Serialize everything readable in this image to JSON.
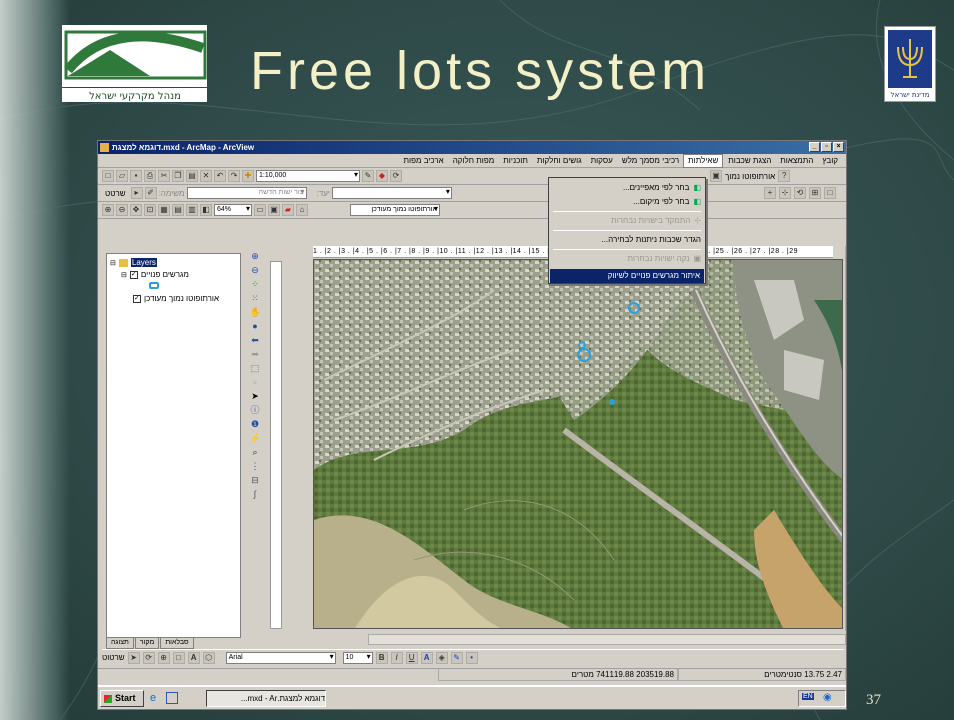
{
  "slide": {
    "title": "Free lots system",
    "page_number": "37",
    "logo_text": "מנהל מקרקעי ישראל",
    "emblem_text": "מדינת ישראל"
  },
  "window": {
    "title": "דוגמא למצגת.mxd - ArcMap - ArcView",
    "buttons": [
      "_",
      "▫",
      "×"
    ]
  },
  "menubar": {
    "items": [
      "קובץ",
      "התמצאות",
      "הצגת שכבות",
      "שאילתות",
      "רכיבי מסמך מלש",
      "עסקות",
      "גושים וחלקות",
      "תוכניות",
      "מפות חלוקה",
      "ארכיב מפות"
    ],
    "active_index": 3
  },
  "toolbar1": {
    "scale": "1:10,000",
    "right_item": "אורתופוטו נמוך"
  },
  "toolbar2": {
    "draw_label": "שרטט",
    "task_label": "משימה:",
    "task_value": "צור ישות חדשה",
    "target_label": "יעד:"
  },
  "toolbar3": {
    "zoom": "64%",
    "layer_combo": "אורתופוטו נמוך מעודכן",
    "number": "0"
  },
  "dropdown": {
    "items": [
      {
        "label": "בחר לפי מאפיינים...",
        "state": "normal"
      },
      {
        "label": "בחר לפי מיקום...",
        "state": "normal"
      },
      {
        "label": "התמקד בישויות נבחרות",
        "state": "disabled"
      },
      {
        "label": "הגדר שכבות ניתנות לבחירה...",
        "state": "normal"
      },
      {
        "label": "נקה ישויות נבחרות",
        "state": "disabled"
      },
      {
        "label": "איתור מגרשים פנויים לשיווק",
        "state": "selected"
      }
    ]
  },
  "toc": {
    "root": "Layers",
    "layers": [
      "מגרשים פנויים",
      "אורתופוטו נמוך מעודכן"
    ],
    "tabs": [
      "תצוגה",
      "מקור",
      "סבלאות"
    ]
  },
  "ruler": {
    "ticks": "1 . |2 . |3 . |4 . |5 . |6 . |7 . |8 . |9 . |10 . |11 . |12 . |13 . |14 . |15 . |16 . |17 . |18 . |19 . |20 . |21 . |22 . |23 . |24 . |25 . |26 . |27 . |28 . |29"
  },
  "drawing_bar": {
    "label": "שרטוט",
    "font": "Arial",
    "size": "10",
    "bold": "B",
    "italic": "I",
    "underline": "U"
  },
  "status": {
    "coords": "203519.88 741119.88 מטרים",
    "scale": "2.47 13.75 סנטימטרים"
  },
  "taskbar": {
    "start": "Start",
    "task": "דוגמא למצגת.mxd - Ar...",
    "lang": "EN"
  },
  "colors": {
    "title": "#f3f0c8",
    "highlight": "#0a246a"
  }
}
